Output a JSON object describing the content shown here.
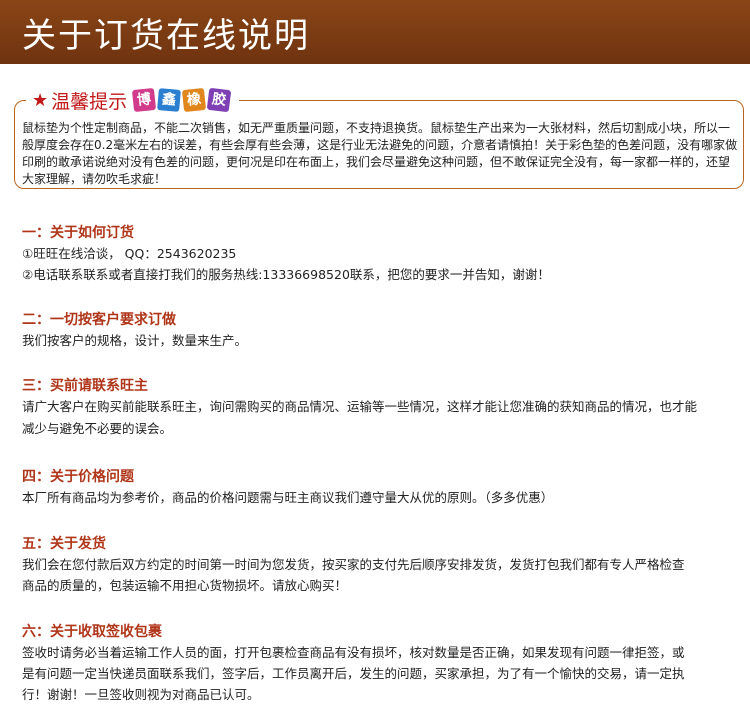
{
  "banner": {
    "title": "关于订货在线说明"
  },
  "notice": {
    "star": "★",
    "title": "温馨提示",
    "brand_chars": [
      "博",
      "鑫",
      "橡",
      "胶"
    ],
    "text": "鼠标垫为个性定制商品，不能二次销售，如无严重质量问题，不支持退换货。鼠标垫生产出来为一大张材料，然后切割成小块，所以一般厚度会存在0.2毫米左右的误差，有些会厚有些会薄，这是行业无法避免的问题，介意者请慎拍！关于彩色垫的色差问题，没有哪家做印刷的敢承诺说绝对没有色差的问题，更何况是印在布面上，我们会尽量避免这种问题，但不敢保证完全没有，每一家都一样的，还望大家理解，请勿吹毛求疵！"
  },
  "sections": [
    {
      "title": "一：关于如何订货",
      "lines": [
        "①旺旺在线洽谈， QQ：2543620235",
        "②电话联系联系或者直接打我们的服务热线:13336698520联系，把您的要求一并告知，谢谢！"
      ]
    },
    {
      "title": "二：一切按客户要求订做",
      "lines": [
        "我们按客户的规格，设计，数量来生产。"
      ]
    },
    {
      "title": "三：买前请联系旺主",
      "lines": [
        "请广大客户在购买前能联系旺主，询问需购买的商品情况、运输等一些情况，这样才能让您准确的获知商品的情况，也才能",
        "减少与避免不必要的误会。"
      ]
    },
    {
      "title": "四：关于价格问题",
      "lines": [
        "本厂所有商品均为参考价，商品的价格问题需与旺主商议我们遵守量大从优的原则。（多多优惠）"
      ]
    },
    {
      "title": "五：关于发货",
      "lines": [
        "我们会在您付款后双方约定的时间第一时间为您发货，按买家的支付先后顺序安排发货，发货打包我们都有专人严格检查",
        "商品的质量的，包装运输不用担心货物损坏。请放心购买！"
      ]
    },
    {
      "title": "六：关于收取签收包裹",
      "lines": [
        "签收时请务必当着运输工作人员的面，打开包裹检查商品有没有损坏，核对数量是否正确，如果发现有问题一律拒签，或",
        "是有问题一定当快递员面联系我们，签字后，工作员离开后，发生的问题，买家承担，为了有一个愉快的交易，请一定执",
        "行！谢谢！一旦签收则视为对商品已认可。"
      ]
    }
  ]
}
